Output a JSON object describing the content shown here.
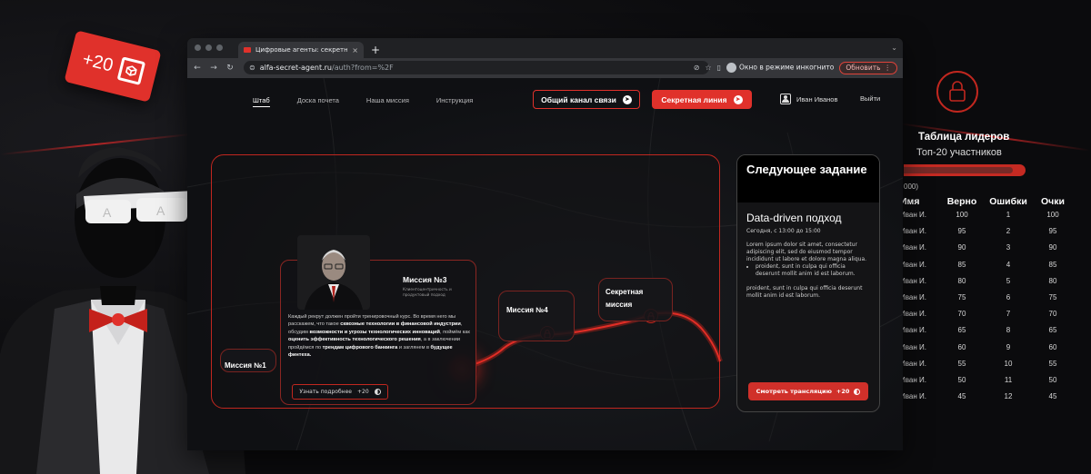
{
  "badge": {
    "points": "+20"
  },
  "browser": {
    "tab_title": "Цифровые агенты: секретна",
    "tab_close": "×",
    "new_tab": "+",
    "url_host": "alfa-secret-agent.ru",
    "url_path": "/auth?from=%2F",
    "incognito_label": "Окно в режиме инкогнито",
    "update_button": "Обновить"
  },
  "site": {
    "nav": [
      "Штаб",
      "Доска почета",
      "Наша миссия",
      "Инструкция"
    ],
    "channel_button": "Общий канал связи",
    "secret_button": "Секретная линия",
    "user_name": "Иван Иванов",
    "logout": "Выйти"
  },
  "missions": {
    "m1": "Миссия №1",
    "m3_title": "Миссия №3",
    "m3_subtitle": "Клиентоцентричность и продуктовый подход",
    "m3_body_1": "Каждый рекрут должен пройти тренировочный курс. Во время него мы расскажем, что такое ",
    "m3_body_b1": "сквозные технологии в финансовой индустрии",
    "m3_body_2": ", обсудим ",
    "m3_body_b2": "возможности и угрозы технологических инноваций",
    "m3_body_3": ", поймём как ",
    "m3_body_b3": "оценить эффективность технологического решения",
    "m3_body_4": ", а в заключении пройдёмся по ",
    "m3_body_b4": "трендам цифрового банкинга",
    "m3_body_5": " и заглянем в ",
    "m3_body_b5": "будущее финтеха.",
    "m3_button": "Узнать подробнее",
    "m3_button_points": "+20",
    "m4": "Миссия №4",
    "secret": "Секретная миссия"
  },
  "next_task": {
    "header": "Следующее задание",
    "title": "Data-driven подход",
    "time": "Сегодня, с 13:00 до 15:00",
    "text_1": "Lorem ipsum dolor sit amet, consectetur adipiscing elit, sed do eiusmod tempor incididunt ut labore et dolore magna aliqua.",
    "bullet": "proident, sunt in culpa qui officia deserunt mollit anim id est laborum.",
    "text_2": "proident, sunt in culpa qui officia deserunt mollit anim id est laborum.",
    "button": "Смотреть трансляцию",
    "button_points": "+20"
  },
  "leaderboard": {
    "title": "Таблица лидеров",
    "subtitle": "Топ-20 участников",
    "range": "000)",
    "columns": [
      "Имя",
      "Верно",
      "Ошибки",
      "Очки"
    ],
    "rows": [
      [
        "Иван И.",
        "100",
        "1",
        "100"
      ],
      [
        "Иван И.",
        "95",
        "2",
        "95"
      ],
      [
        "Иван И.",
        "90",
        "3",
        "90"
      ],
      [
        "Иван И.",
        "85",
        "4",
        "85"
      ],
      [
        "Иван И.",
        "80",
        "5",
        "80"
      ],
      [
        "Иван И.",
        "75",
        "6",
        "75"
      ],
      [
        "Иван И.",
        "70",
        "7",
        "70"
      ],
      [
        "Иван И.",
        "65",
        "8",
        "65"
      ],
      [
        "Иван И.",
        "60",
        "9",
        "60"
      ],
      [
        "Иван И.",
        "55",
        "10",
        "55"
      ],
      [
        "Иван И.",
        "50",
        "11",
        "50"
      ],
      [
        "Иван И.",
        "45",
        "12",
        "45"
      ]
    ]
  },
  "colors": {
    "accent": "#e0312b",
    "background": "#0c0c0e"
  }
}
